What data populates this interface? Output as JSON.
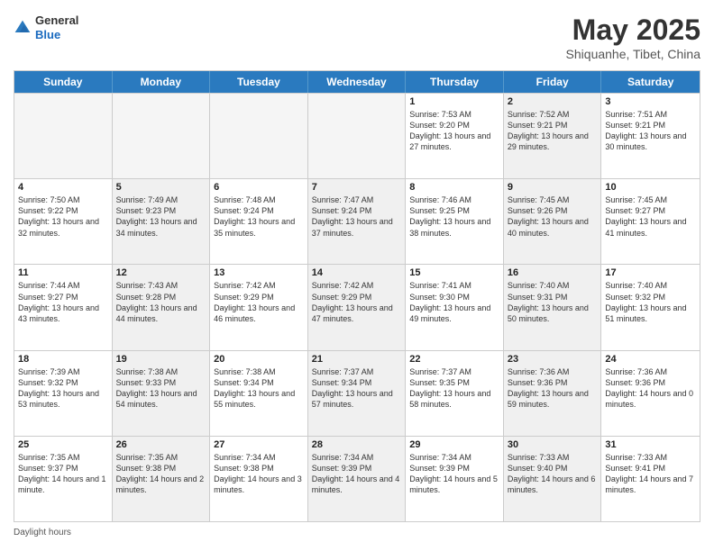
{
  "header": {
    "logo": {
      "line1": "General",
      "line2": "Blue"
    },
    "title": "May 2025",
    "subtitle": "Shiquanhe, Tibet, China"
  },
  "days_of_week": [
    "Sunday",
    "Monday",
    "Tuesday",
    "Wednesday",
    "Thursday",
    "Friday",
    "Saturday"
  ],
  "weeks": [
    [
      {
        "day": "",
        "sunrise": "",
        "sunset": "",
        "daylight": "",
        "shaded": true
      },
      {
        "day": "",
        "sunrise": "",
        "sunset": "",
        "daylight": "",
        "shaded": true
      },
      {
        "day": "",
        "sunrise": "",
        "sunset": "",
        "daylight": "",
        "shaded": true
      },
      {
        "day": "",
        "sunrise": "",
        "sunset": "",
        "daylight": "",
        "shaded": true
      },
      {
        "day": "1",
        "sunrise": "Sunrise: 7:53 AM",
        "sunset": "Sunset: 9:20 PM",
        "daylight": "Daylight: 13 hours and 27 minutes.",
        "shaded": false
      },
      {
        "day": "2",
        "sunrise": "Sunrise: 7:52 AM",
        "sunset": "Sunset: 9:21 PM",
        "daylight": "Daylight: 13 hours and 29 minutes.",
        "shaded": true
      },
      {
        "day": "3",
        "sunrise": "Sunrise: 7:51 AM",
        "sunset": "Sunset: 9:21 PM",
        "daylight": "Daylight: 13 hours and 30 minutes.",
        "shaded": false
      }
    ],
    [
      {
        "day": "4",
        "sunrise": "Sunrise: 7:50 AM",
        "sunset": "Sunset: 9:22 PM",
        "daylight": "Daylight: 13 hours and 32 minutes.",
        "shaded": false
      },
      {
        "day": "5",
        "sunrise": "Sunrise: 7:49 AM",
        "sunset": "Sunset: 9:23 PM",
        "daylight": "Daylight: 13 hours and 34 minutes.",
        "shaded": true
      },
      {
        "day": "6",
        "sunrise": "Sunrise: 7:48 AM",
        "sunset": "Sunset: 9:24 PM",
        "daylight": "Daylight: 13 hours and 35 minutes.",
        "shaded": false
      },
      {
        "day": "7",
        "sunrise": "Sunrise: 7:47 AM",
        "sunset": "Sunset: 9:24 PM",
        "daylight": "Daylight: 13 hours and 37 minutes.",
        "shaded": true
      },
      {
        "day": "8",
        "sunrise": "Sunrise: 7:46 AM",
        "sunset": "Sunset: 9:25 PM",
        "daylight": "Daylight: 13 hours and 38 minutes.",
        "shaded": false
      },
      {
        "day": "9",
        "sunrise": "Sunrise: 7:45 AM",
        "sunset": "Sunset: 9:26 PM",
        "daylight": "Daylight: 13 hours and 40 minutes.",
        "shaded": true
      },
      {
        "day": "10",
        "sunrise": "Sunrise: 7:45 AM",
        "sunset": "Sunset: 9:27 PM",
        "daylight": "Daylight: 13 hours and 41 minutes.",
        "shaded": false
      }
    ],
    [
      {
        "day": "11",
        "sunrise": "Sunrise: 7:44 AM",
        "sunset": "Sunset: 9:27 PM",
        "daylight": "Daylight: 13 hours and 43 minutes.",
        "shaded": false
      },
      {
        "day": "12",
        "sunrise": "Sunrise: 7:43 AM",
        "sunset": "Sunset: 9:28 PM",
        "daylight": "Daylight: 13 hours and 44 minutes.",
        "shaded": true
      },
      {
        "day": "13",
        "sunrise": "Sunrise: 7:42 AM",
        "sunset": "Sunset: 9:29 PM",
        "daylight": "Daylight: 13 hours and 46 minutes.",
        "shaded": false
      },
      {
        "day": "14",
        "sunrise": "Sunrise: 7:42 AM",
        "sunset": "Sunset: 9:29 PM",
        "daylight": "Daylight: 13 hours and 47 minutes.",
        "shaded": true
      },
      {
        "day": "15",
        "sunrise": "Sunrise: 7:41 AM",
        "sunset": "Sunset: 9:30 PM",
        "daylight": "Daylight: 13 hours and 49 minutes.",
        "shaded": false
      },
      {
        "day": "16",
        "sunrise": "Sunrise: 7:40 AM",
        "sunset": "Sunset: 9:31 PM",
        "daylight": "Daylight: 13 hours and 50 minutes.",
        "shaded": true
      },
      {
        "day": "17",
        "sunrise": "Sunrise: 7:40 AM",
        "sunset": "Sunset: 9:32 PM",
        "daylight": "Daylight: 13 hours and 51 minutes.",
        "shaded": false
      }
    ],
    [
      {
        "day": "18",
        "sunrise": "Sunrise: 7:39 AM",
        "sunset": "Sunset: 9:32 PM",
        "daylight": "Daylight: 13 hours and 53 minutes.",
        "shaded": false
      },
      {
        "day": "19",
        "sunrise": "Sunrise: 7:38 AM",
        "sunset": "Sunset: 9:33 PM",
        "daylight": "Daylight: 13 hours and 54 minutes.",
        "shaded": true
      },
      {
        "day": "20",
        "sunrise": "Sunrise: 7:38 AM",
        "sunset": "Sunset: 9:34 PM",
        "daylight": "Daylight: 13 hours and 55 minutes.",
        "shaded": false
      },
      {
        "day": "21",
        "sunrise": "Sunrise: 7:37 AM",
        "sunset": "Sunset: 9:34 PM",
        "daylight": "Daylight: 13 hours and 57 minutes.",
        "shaded": true
      },
      {
        "day": "22",
        "sunrise": "Sunrise: 7:37 AM",
        "sunset": "Sunset: 9:35 PM",
        "daylight": "Daylight: 13 hours and 58 minutes.",
        "shaded": false
      },
      {
        "day": "23",
        "sunrise": "Sunrise: 7:36 AM",
        "sunset": "Sunset: 9:36 PM",
        "daylight": "Daylight: 13 hours and 59 minutes.",
        "shaded": true
      },
      {
        "day": "24",
        "sunrise": "Sunrise: 7:36 AM",
        "sunset": "Sunset: 9:36 PM",
        "daylight": "Daylight: 14 hours and 0 minutes.",
        "shaded": false
      }
    ],
    [
      {
        "day": "25",
        "sunrise": "Sunrise: 7:35 AM",
        "sunset": "Sunset: 9:37 PM",
        "daylight": "Daylight: 14 hours and 1 minute.",
        "shaded": false
      },
      {
        "day": "26",
        "sunrise": "Sunrise: 7:35 AM",
        "sunset": "Sunset: 9:38 PM",
        "daylight": "Daylight: 14 hours and 2 minutes.",
        "shaded": true
      },
      {
        "day": "27",
        "sunrise": "Sunrise: 7:34 AM",
        "sunset": "Sunset: 9:38 PM",
        "daylight": "Daylight: 14 hours and 3 minutes.",
        "shaded": false
      },
      {
        "day": "28",
        "sunrise": "Sunrise: 7:34 AM",
        "sunset": "Sunset: 9:39 PM",
        "daylight": "Daylight: 14 hours and 4 minutes.",
        "shaded": true
      },
      {
        "day": "29",
        "sunrise": "Sunrise: 7:34 AM",
        "sunset": "Sunset: 9:39 PM",
        "daylight": "Daylight: 14 hours and 5 minutes.",
        "shaded": false
      },
      {
        "day": "30",
        "sunrise": "Sunrise: 7:33 AM",
        "sunset": "Sunset: 9:40 PM",
        "daylight": "Daylight: 14 hours and 6 minutes.",
        "shaded": true
      },
      {
        "day": "31",
        "sunrise": "Sunrise: 7:33 AM",
        "sunset": "Sunset: 9:41 PM",
        "daylight": "Daylight: 14 hours and 7 minutes.",
        "shaded": false
      }
    ]
  ],
  "footer": {
    "daylight_label": "Daylight hours"
  }
}
